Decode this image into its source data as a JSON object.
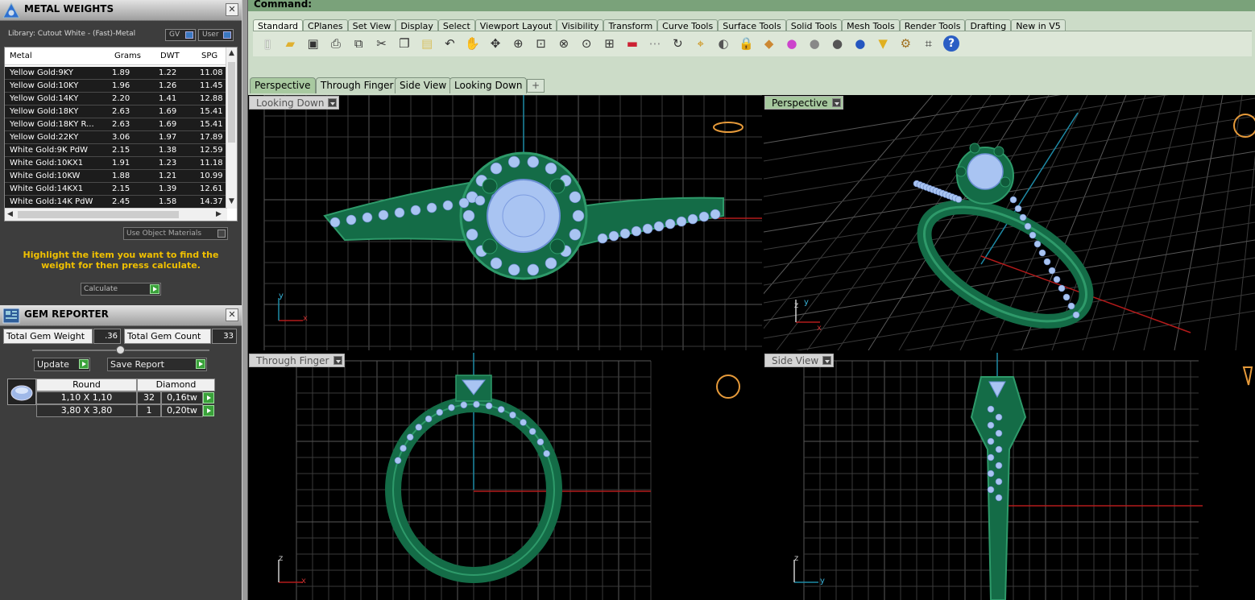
{
  "metal_weights": {
    "title": "METAL WEIGHTS",
    "library": "Library: Cutout White - (Fast)-Metal",
    "gv_label": "GV",
    "user_label": "User",
    "columns": [
      "Metal",
      "Grams",
      "DWT",
      "SPG"
    ],
    "rows": [
      [
        "Yellow Gold:9KY",
        "1.89",
        "1.22",
        "11.08"
      ],
      [
        "Yellow Gold:10KY",
        "1.96",
        "1.26",
        "11.45"
      ],
      [
        "Yellow Gold:14KY",
        "2.20",
        "1.41",
        "12.88"
      ],
      [
        "Yellow Gold:18KY",
        "2.63",
        "1.69",
        "15.41"
      ],
      [
        "Yellow Gold:18KY R...",
        "2.63",
        "1.69",
        "15.41"
      ],
      [
        "Yellow Gold:22KY",
        "3.06",
        "1.97",
        "17.89"
      ],
      [
        "White Gold:9K PdW",
        "2.15",
        "1.38",
        "12.59"
      ],
      [
        "White Gold:10KX1",
        "1.91",
        "1.23",
        "11.18"
      ],
      [
        "White Gold:10KW",
        "1.88",
        "1.21",
        "10.99"
      ],
      [
        "White Gold:14KX1",
        "2.15",
        "1.39",
        "12.61"
      ],
      [
        "White Gold:14K PdW",
        "2.45",
        "1.58",
        "14.37"
      ]
    ],
    "use_object_materials": "Use Object Materials",
    "hint": "Highlight the item you want to find the weight for then press calculate.",
    "calculate": "Calculate"
  },
  "gem_reporter": {
    "title": "GEM REPORTER",
    "total_weight_label": "Total Gem Weight",
    "total_weight_value": ".36",
    "total_count_label": "Total Gem Count",
    "total_count_value": "33",
    "update": "Update",
    "save_report": "Save Report",
    "table_header": [
      "Round",
      "Diamond"
    ],
    "rows": [
      [
        "1,10 X 1,10",
        "32",
        "0,16tw"
      ],
      [
        "3,80 X 3,80",
        "1",
        "0,20tw"
      ]
    ]
  },
  "command": {
    "label": "Command:"
  },
  "toolbar_tabs": [
    "Standard",
    "CPlanes",
    "Set View",
    "Display",
    "Select",
    "Viewport Layout",
    "Visibility",
    "Transform",
    "Curve Tools",
    "Surface Tools",
    "Solid Tools",
    "Mesh Tools",
    "Render Tools",
    "Drafting",
    "New in V5"
  ],
  "toolbar_icons": [
    "new-file",
    "open-folder",
    "save",
    "print",
    "import",
    "cut",
    "copy",
    "paste",
    "undo",
    "pan-hand",
    "move",
    "zoom-in",
    "zoom-window",
    "zoom-extents",
    "zoom-selected",
    "four-viewports",
    "car",
    "dim",
    "rotate-view",
    "snap",
    "light-bulb",
    "lock",
    "layers",
    "color-wheel",
    "sphere-grey",
    "sphere-dark",
    "sphere-blue",
    "highlighter",
    "gears",
    "grid-snap",
    "help"
  ],
  "view_tabs": [
    "Perspective",
    "Through Finger",
    "Side View",
    "Looking Down"
  ],
  "viewports": {
    "top_left": "Looking Down",
    "top_right": "Perspective",
    "bottom_left": "Through Finger",
    "bottom_right": "Side View"
  },
  "axis_labels": {
    "x": "x",
    "y": "y",
    "z": "z"
  },
  "colors": {
    "metal": "#146c47",
    "metal_light": "#2e9a6a",
    "gem": "#a9c4f2",
    "grid": "#3a3a3a",
    "grid_major": "#585858",
    "axis_x": "#b31a1a",
    "axis_y": "#1e8aa6",
    "hint": "#f0c000",
    "command_bar": "#7aa27a"
  }
}
